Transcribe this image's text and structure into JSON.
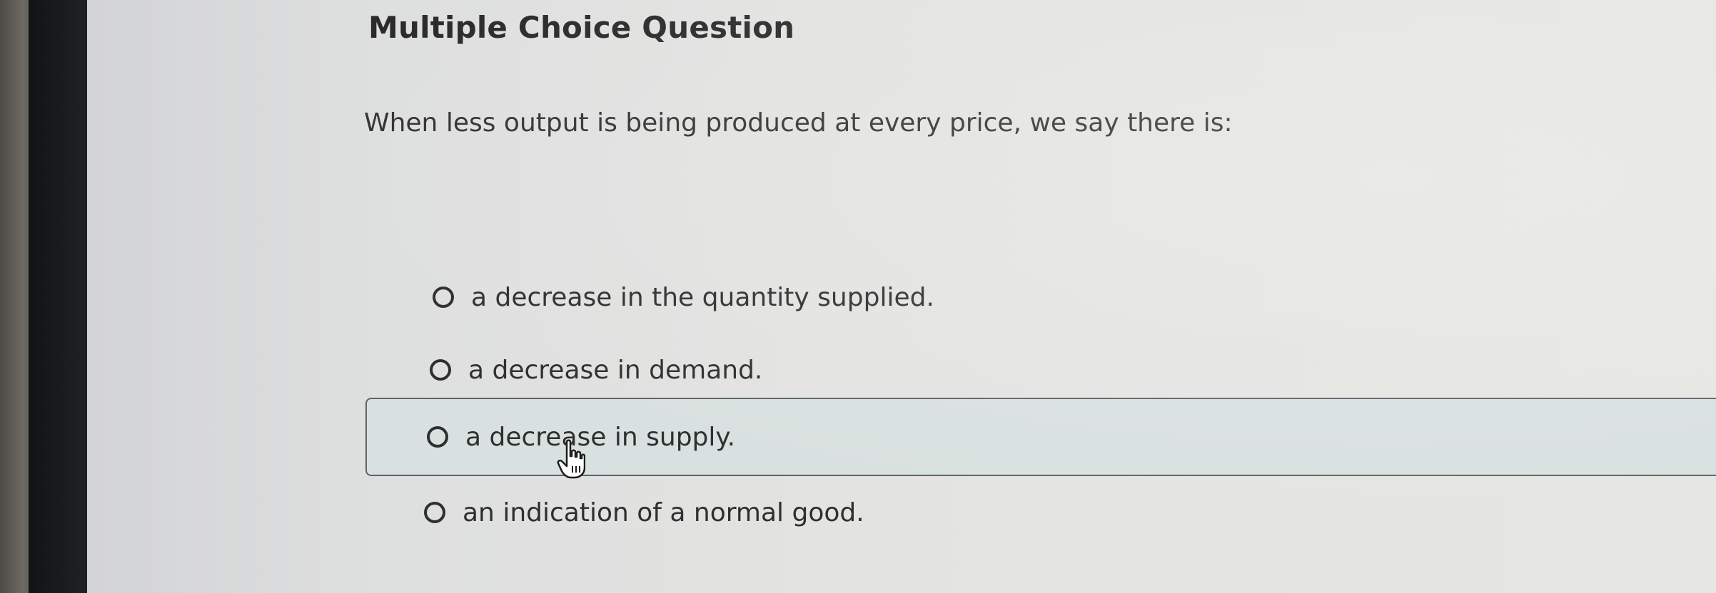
{
  "quiz": {
    "heading": "Multiple Choice Question",
    "question": "When less output is being produced at every price, we say there is:",
    "options": [
      {
        "label": "a decrease in the quantity supplied."
      },
      {
        "label": "a decrease in demand."
      },
      {
        "label": "a decrease in supply."
      },
      {
        "label": "an indication of a normal good."
      }
    ]
  },
  "state": {
    "hovered_option_index": 2,
    "selected_option_index": null
  },
  "colors": {
    "hover_background": "#d9e1e0",
    "hover_border": "#5d6566",
    "text": "#2f2f2f"
  },
  "icons": {
    "option_marker": "radio-button-icon",
    "pointer": "hand-pointer-icon"
  }
}
